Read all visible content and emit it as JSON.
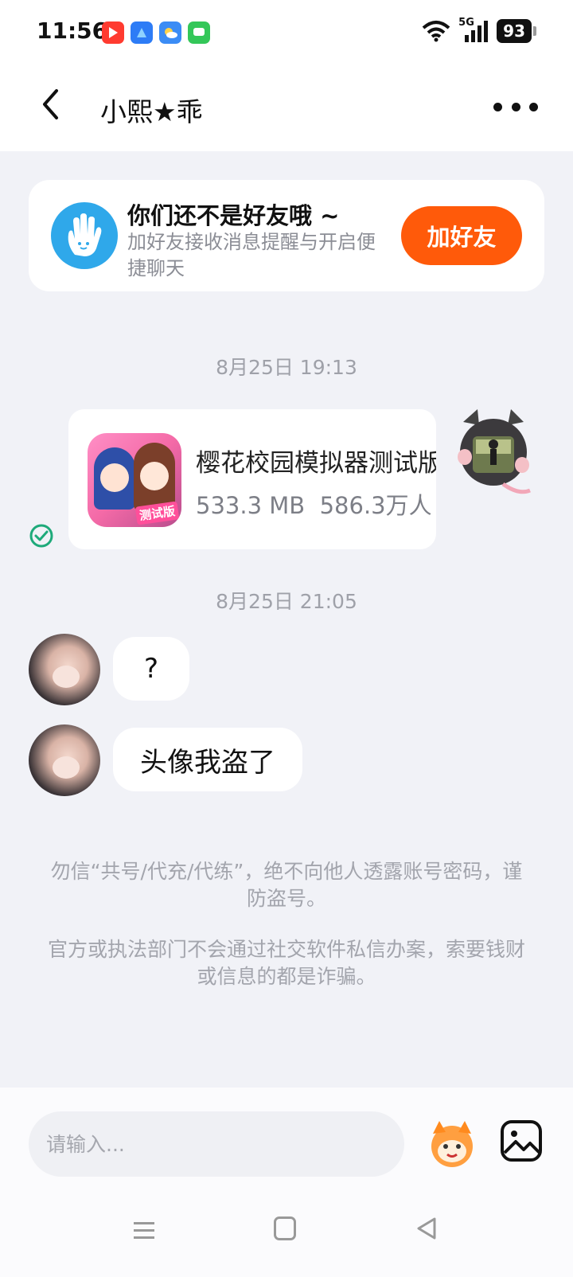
{
  "status_bar": {
    "time": "11:56",
    "network": "5G",
    "battery": "93"
  },
  "header": {
    "title": "小熙★乖"
  },
  "friend_banner": {
    "title": "你们还不是好友哦 ~",
    "subtitle": "加好友接收消息提醒与开启便捷聊天",
    "button": "加好友"
  },
  "messages": {
    "time_1": "8月25日 19:13",
    "app_share": {
      "name": "樱花校园模拟器测试版",
      "size": "533.3 MB",
      "downloads": "586.3万人",
      "icon_badge": "测试版"
    },
    "time_2": "8月25日 21:05",
    "msg_1": "?",
    "msg_2": "头像我盗了"
  },
  "warnings": {
    "line_1": "勿信“共号/代充/代练”，绝不向他人透露账号密码，谨防盗号。",
    "line_2": "官方或执法部门不会通过社交软件私信办案，索要钱财或信息的都是诈骗。"
  },
  "input": {
    "placeholder": "请输入..."
  }
}
